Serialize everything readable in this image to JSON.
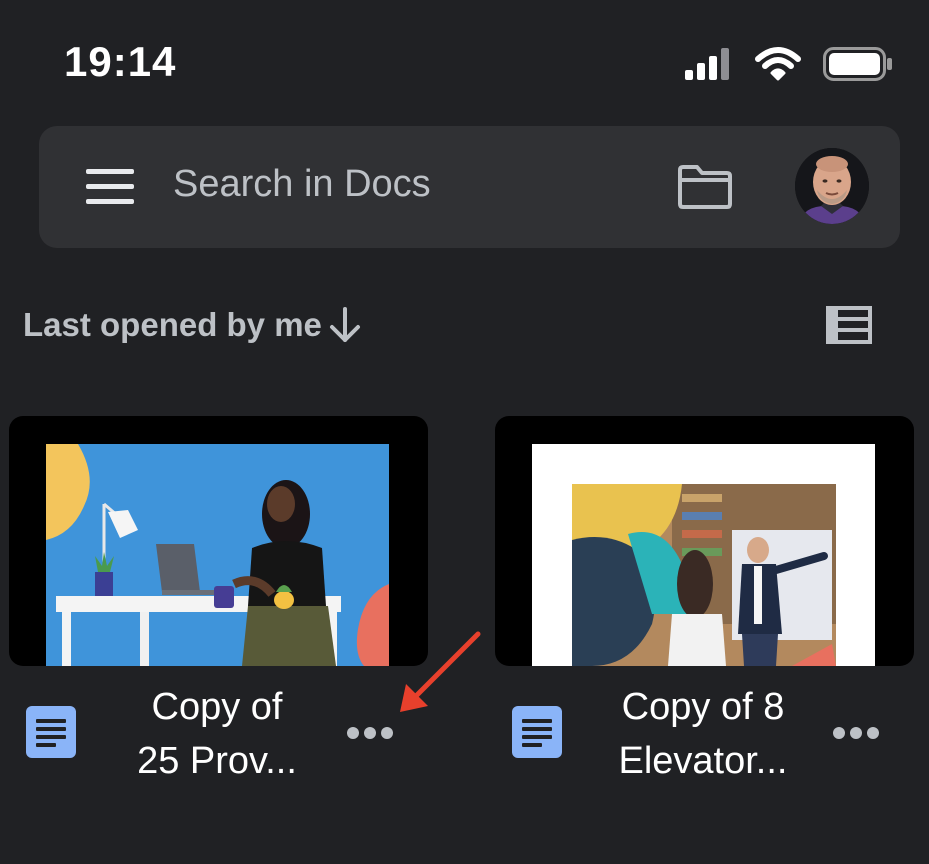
{
  "status_bar": {
    "time": "19:14",
    "icons": [
      "cellular-signal-icon",
      "wifi-icon",
      "battery-icon"
    ]
  },
  "search": {
    "placeholder": "Search in Docs",
    "icons": [
      "menu-icon",
      "folder-icon",
      "avatar"
    ]
  },
  "sort": {
    "label": "Last opened by me",
    "direction_icon": "arrow-down-icon",
    "view_toggle_icon": "list-view-icon"
  },
  "documents": [
    {
      "title_line1": "Copy of",
      "title_line2": "25 Prov...",
      "type_icon": "docs-file-icon",
      "more_icon": "more-horizontal-icon"
    },
    {
      "title_line1": "Copy of 8",
      "title_line2": "Elevator...",
      "type_icon": "docs-file-icon",
      "more_icon": "more-horizontal-icon"
    }
  ],
  "annotation": {
    "icon": "red-arrow-annotation",
    "color": "#e8402c"
  },
  "colors": {
    "background": "#202124",
    "search_bar": "#303134",
    "docs_icon": "#8ab4f8",
    "text_primary": "#ffffff",
    "text_secondary": "#bdc1c6"
  }
}
